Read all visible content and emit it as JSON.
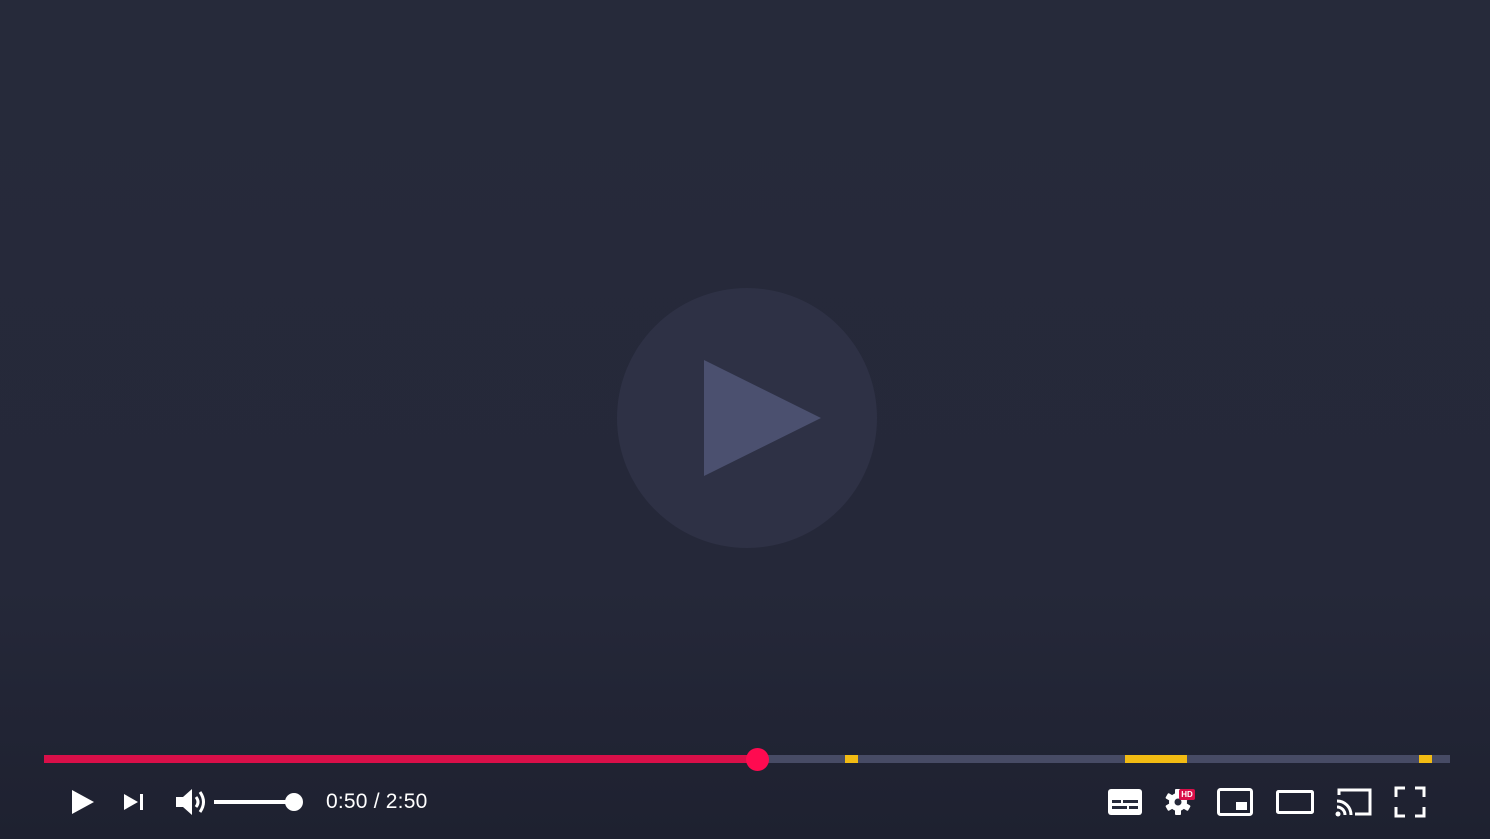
{
  "player": {
    "colors": {
      "accent": "#d90f49",
      "scrubber": "#ff0a50",
      "track": "#474b65",
      "marker": "#f2bb13",
      "background": "#262a3a",
      "big_play_circle": "#2e3145",
      "big_play_triangle": "#4b506f"
    },
    "big_play_icon": "play-triangle",
    "progress": {
      "played_fraction": 0.507,
      "markers": [
        {
          "start": 0.57,
          "end": 0.579
        },
        {
          "start": 0.769,
          "end": 0.813
        },
        {
          "start": 0.978,
          "end": 0.987
        }
      ]
    },
    "volume": {
      "level": 1.0
    },
    "time": {
      "current": "0:50",
      "separator": " / ",
      "duration": "2:50"
    },
    "settings_badge": "HD",
    "icons": {
      "play": "play-icon",
      "next": "skip-next-icon",
      "volume": "volume-high-icon",
      "subtitles": "subtitles-icon",
      "settings": "gear-icon",
      "miniplayer": "miniplayer-icon",
      "theater": "theater-mode-icon",
      "cast": "cast-icon",
      "fullscreen": "fullscreen-icon"
    }
  }
}
